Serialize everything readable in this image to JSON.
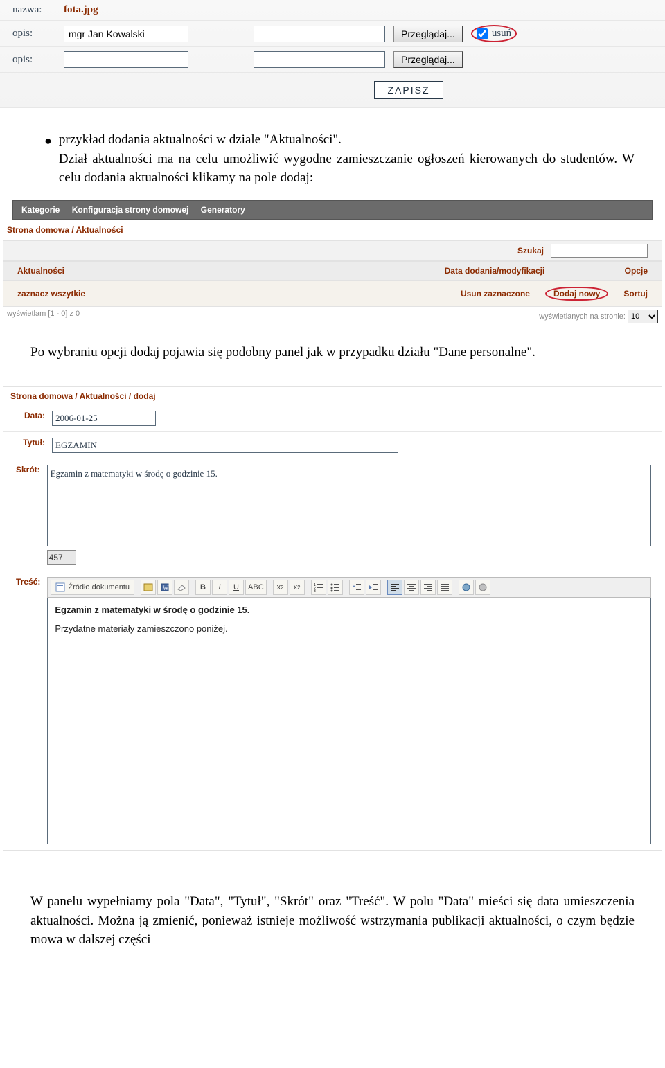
{
  "upload": {
    "nazwa_label": "nazwa:",
    "nazwa_value": "fota.jpg",
    "opis_label": "opis:",
    "opis1_value": "mgr Jan Kowalski",
    "browse_label": "Przeglądaj...",
    "usun_label": "usuń",
    "save_label": "ZAPISZ"
  },
  "text": {
    "bullet_line": "przykład dodania aktualności w dziale \"Aktualności\".",
    "paragraph1": "Dział aktualności ma na celu umożliwić wygodne zamieszczanie ogłoszeń kierowanych do studentów. W celu dodania aktualności klikamy na pole dodaj:",
    "paragraph2": "Po wybraniu opcji dodaj pojawia się podobny panel jak w przypadku działu \"Dane personalne\".",
    "paragraph3": "W panelu wypełniamy pola \"Data\", \"Tytuł\", \"Skrót\" oraz \"Treść\". W polu \"Data\" mieści się data umieszczenia aktualności. Można ją zmienić, ponieważ istnieje możliwość wstrzymania publikacji aktualności, o czym będzie mowa w dalszej części"
  },
  "nav": {
    "kategorie": "Kategorie",
    "konfiguracja": "Konfiguracja strony domowej",
    "generatory": "Generatory"
  },
  "list": {
    "breadcrumb": "Strona domowa / Aktualności",
    "search_label": "Szukaj",
    "col_aktualnosci": "Aktualności",
    "col_data": "Data dodania/modyfikacji",
    "col_opcje": "Opcje",
    "zaznacz": "zaznacz wszytkie",
    "usun_z": "Usun zaznaczone",
    "dodaj": "Dodaj nowy",
    "sortuj": "Sortuj",
    "status_left": "wyświetlam [1 - 0] z 0",
    "status_right": "wyświetlanych na stronie:",
    "per_page": "10"
  },
  "add": {
    "breadcrumb": "Strona domowa / Aktualności / dodaj",
    "data_label": "Data:",
    "data_value": "2006-01-25",
    "tytul_label": "Tytuł:",
    "tytul_value": "EGZAMIN",
    "skrot_label": "Skrót:",
    "skrot_value": "Egzamin z matematyki w środę o godzinie 15.",
    "counter": "457",
    "tresc_label": "Treść:",
    "source_btn": "Źródło dokumentu",
    "content_bold": "Egzamin z matematyki w środę o godzinie 15.",
    "content_line2": "Przydatne materiały zamieszczono poniżej."
  }
}
